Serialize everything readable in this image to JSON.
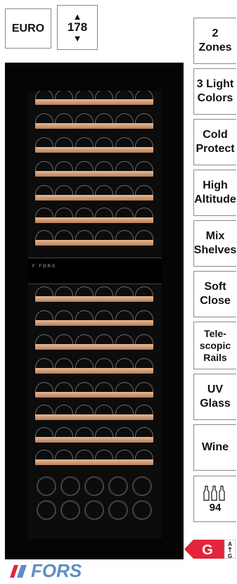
{
  "badges": {
    "euro": "EURO",
    "height_value": "178",
    "arrow_up": "▲",
    "arrow_down": "▼"
  },
  "features": [
    {
      "line1": "2",
      "line2": "Zones"
    },
    {
      "line1": "3 Light",
      "line2": "Colors"
    },
    {
      "line1": "Cold",
      "line2": "Protect"
    },
    {
      "line1": "High",
      "line2": "Altitude"
    },
    {
      "line1": "Mix",
      "line2": "Shelves"
    },
    {
      "line1": "Soft",
      "line2": "Close"
    },
    {
      "line1": "Tele-",
      "line2": "scopic",
      "line3": "Rails"
    },
    {
      "line1": "UV",
      "line2": "Glass"
    },
    {
      "line1": "Wine"
    }
  ],
  "capacity": "94",
  "energy": {
    "class": "G",
    "scale_top": "A",
    "scale_bottom": "G",
    "color": "#e2253b"
  },
  "brand": {
    "name": "FORS",
    "color": "#5c8ec8",
    "accent": "#e2253b"
  },
  "panel_text": "F FORS"
}
